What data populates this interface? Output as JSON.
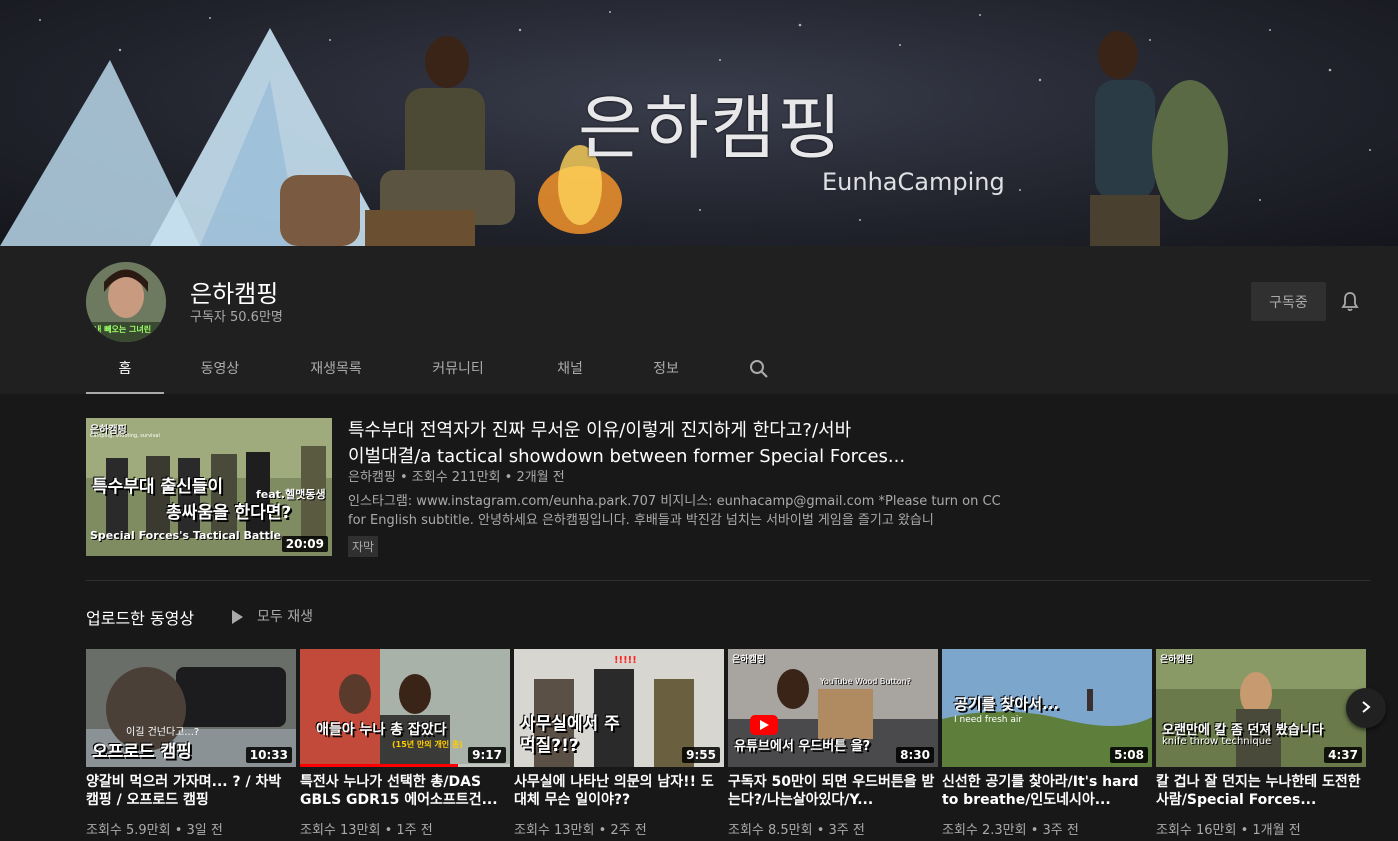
{
  "banner": {
    "title": "은하캠핑",
    "subtitle": "EunhaCamping"
  },
  "channel": {
    "name": "은하캠핑",
    "subscribers": "구독자 50.6만명",
    "subscribe_label": "구독중",
    "avatar_caption": "내 빼오는 그녀린"
  },
  "tabs": [
    {
      "label": "홈"
    },
    {
      "label": "동영상"
    },
    {
      "label": "재생목록"
    },
    {
      "label": "커뮤니티"
    },
    {
      "label": "채널"
    },
    {
      "label": "정보"
    }
  ],
  "featured": {
    "title": "특수부대 전역자가 진짜 무서운 이유/이렇게 진지하게 한다고?/서바이벌대결/a tactical showdown between former Special Forces...",
    "title_line1": "특수부대 전역자가 진짜 무서운 이유/이렇게 진지하게 한다고?/서바",
    "title_line2": "이벌대결/a tactical showdown between former Special Forces...",
    "meta": "은하캠핑 • 조회수 211만회 • 2개월 전",
    "desc_line1": "인스타그램: www.instagram.com/eunha.park.707 비지니스: eunhacamp@gmail.com *Please turn on CC",
    "desc_line2": "for English subtitle. 안녕하세요 은하캠핑입니다. 후배들과 박진감 넘치는 서바이벌 게임을 즐기고 왔습니",
    "badge": "자막",
    "duration": "20:09",
    "thumb_brand": "은하캠핑",
    "thumb_brand_sub": "Camping, shooting, survival",
    "thumb_line1": "특수부대 출신들이",
    "thumb_line2": "총싸움을 한다면?",
    "thumb_feat": "feat.헬맷동생",
    "thumb_en": "Special Forces's Tactical Battle"
  },
  "shelf": {
    "title": "업로드한 동영상",
    "play_all": "모두 재생"
  },
  "videos": [
    {
      "title": "양갈비 먹으러 가자며... ? / 차박 캠핑 / 오프로드 캠핑",
      "meta": "조회수 5.9만회 • 3일 전",
      "duration": "10:33",
      "thumb_text": "오프로드 캠핑",
      "thumb_small": "이길 건넌다고...?"
    },
    {
      "title": "특전사 누나가 선택한 총/DAS GBLS GDR15 에어소프트건...",
      "meta": "조회수 13만회 • 1주 전",
      "duration": "9:17",
      "thumb_text": "애들아 누나 총 잡았다",
      "thumb_small": "(15년 만의 개인 총)",
      "progress": 0.75
    },
    {
      "title": "사무실에 나타난 의문의 남자!! 도대체 무슨 일이야??",
      "meta": "조회수 13만회 • 2주 전",
      "duration": "9:55",
      "thumb_text": "사무실에서 주먹질?!?",
      "thumb_small": "!!!!!"
    },
    {
      "title": "구독자 50만이 되면 우드버튼을 받는다?/나는살아있다/Y...",
      "meta": "조회수 8.5만회 • 3주 전",
      "duration": "8:30",
      "thumb_text": "유튜브에서 우드버튼 을?",
      "thumb_small": "YouTube Wood Button?",
      "thumb_brand": "은하캠핑"
    },
    {
      "title": "신선한 공기를 찾아라/It's hard to breathe/인도네시아...",
      "meta": "조회수 2.3만회 • 3주 전",
      "duration": "5:08",
      "thumb_text": "공기를 찾아서...",
      "thumb_small": "I need fresh air"
    },
    {
      "title": "칼 겁나 잘 던지는 누나한테 도전한 사람/Special Forces...",
      "meta": "조회수 16만회 • 1개월 전",
      "duration": "4:37",
      "thumb_text": "오랜만에 칼 좀 던져 봤습니다",
      "thumb_small": "knife throw technique",
      "thumb_brand": "은하캠핑"
    }
  ],
  "colors": {
    "background": "#181818",
    "header": "#202020",
    "accent_red": "#ff0000",
    "muted_text": "#aaaaaa"
  },
  "icons": {
    "bell": "bell-icon",
    "search": "search-icon",
    "next": "chevron-right-icon",
    "play": "play-icon"
  }
}
